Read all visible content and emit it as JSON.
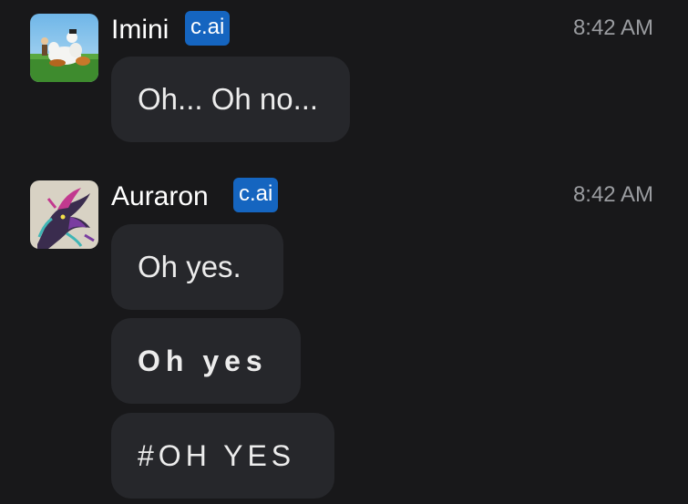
{
  "messages": [
    {
      "author": "Imini",
      "badge": "c.ai",
      "time": "8:42 AM",
      "avatar_icon": "imini-avatar",
      "bubbles": [
        "Oh... Oh no..."
      ]
    },
    {
      "author": "Auraron",
      "badge": "c.ai",
      "time": "8:42 AM",
      "avatar_icon": "auraron-dragon-avatar",
      "bubbles": [
        "Oh yes.",
        "Oh yes",
        "#OH YES"
      ]
    }
  ],
  "colors": {
    "background": "#18181a",
    "bubble": "#26272b",
    "badge": "#1565c0",
    "timestamp": "#9a9ca0"
  }
}
